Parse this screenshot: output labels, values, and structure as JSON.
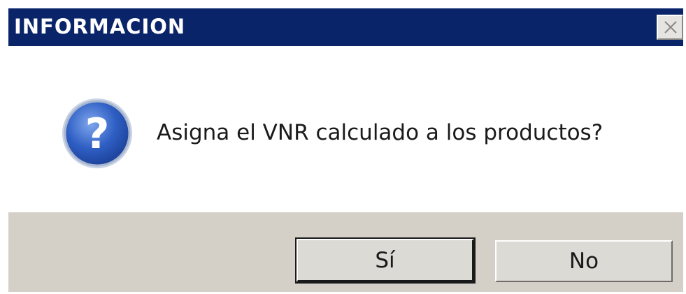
{
  "window": {
    "title": "INFORMACION",
    "close_icon": "close-icon"
  },
  "body": {
    "icon": "question-icon",
    "message": "Asigna el VNR calculado a los productos?"
  },
  "buttons": {
    "yes_label": "Sí",
    "no_label": "No"
  },
  "colors": {
    "titlebar": "#0a246a",
    "footer": "#d4d0c8",
    "icon_blue": "#2a56b8"
  }
}
